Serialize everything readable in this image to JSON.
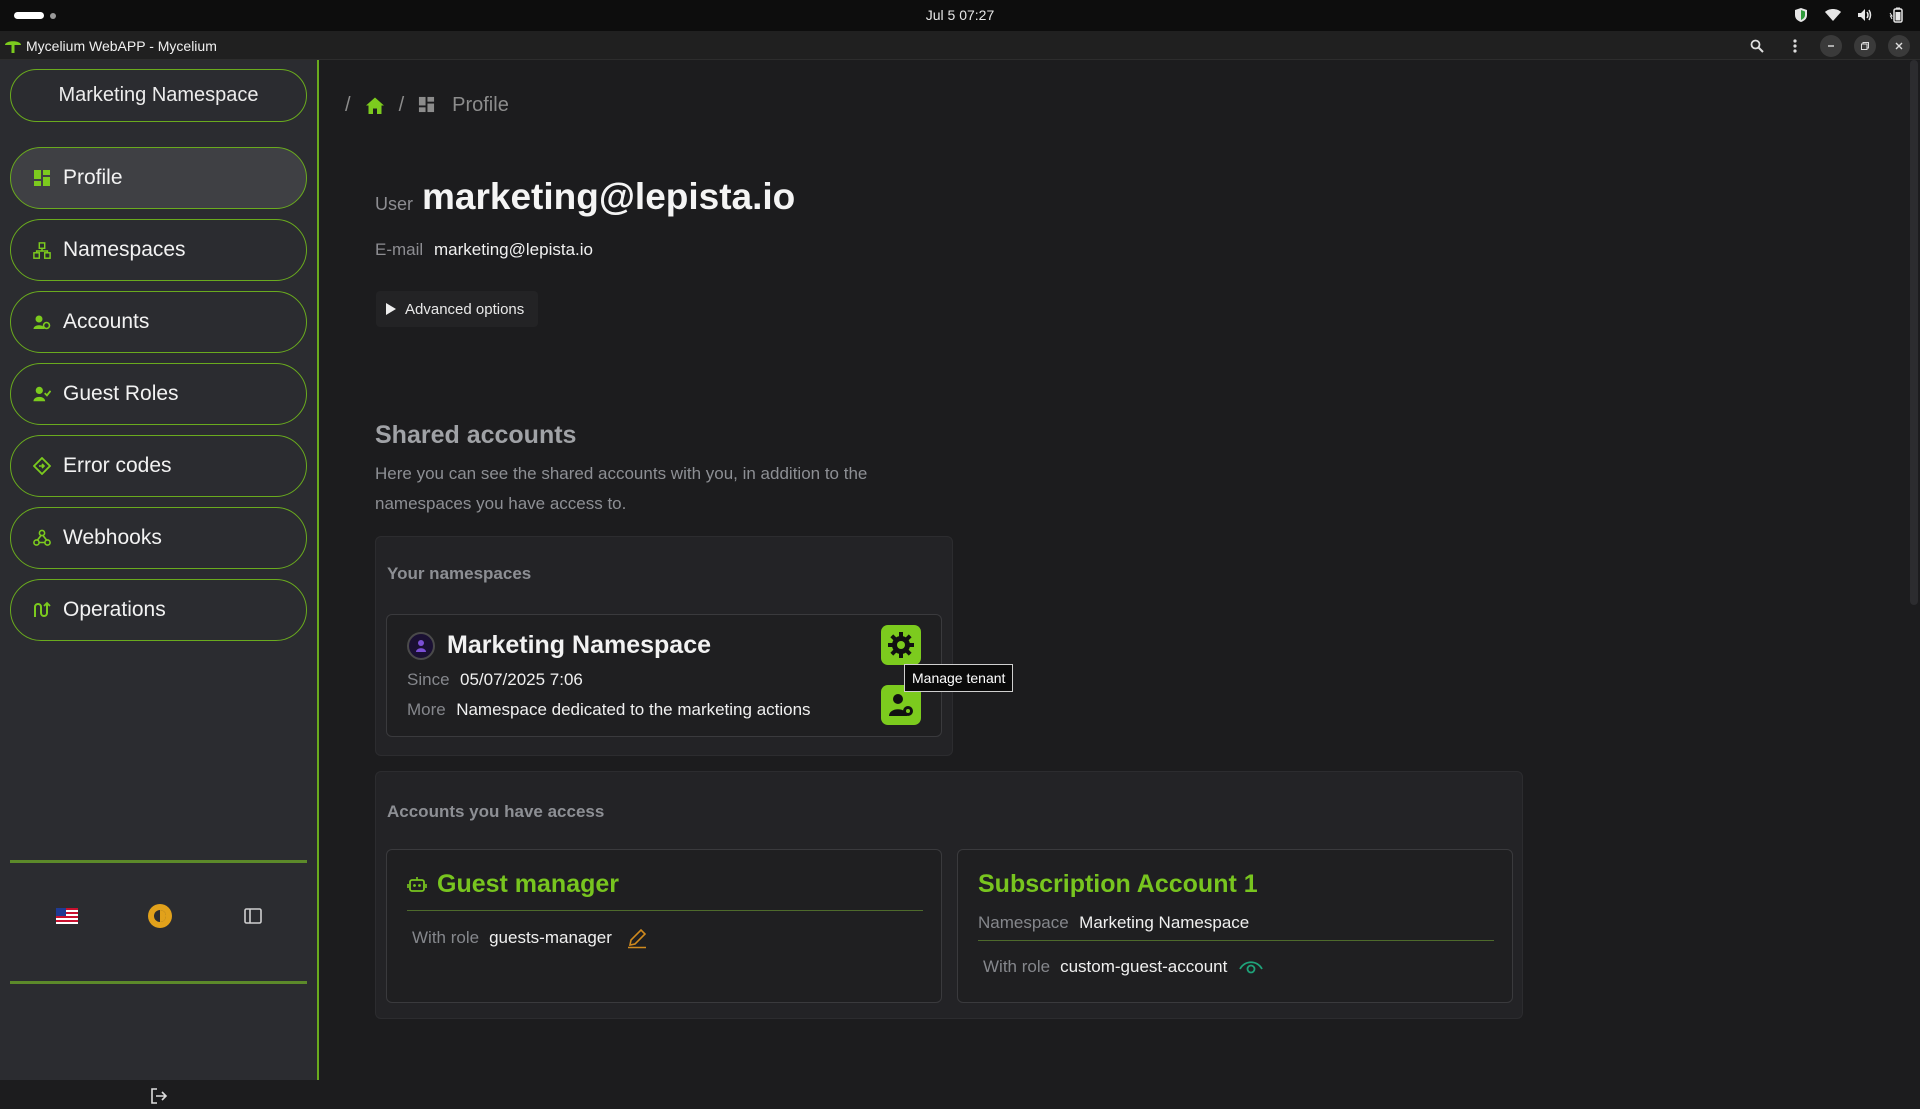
{
  "os": {
    "clock": "Jul 5  07:27"
  },
  "window": {
    "title": "Mycelium WebAPP - Mycelium"
  },
  "sidebar": {
    "namespace_selector": "Marketing Namespace",
    "items": [
      {
        "label": "Profile",
        "icon": "grid-icon",
        "active": true
      },
      {
        "label": "Namespaces",
        "icon": "namespaces-icon",
        "active": false
      },
      {
        "label": "Accounts",
        "icon": "accounts-icon",
        "active": false
      },
      {
        "label": "Guest Roles",
        "icon": "guest-roles-icon",
        "active": false
      },
      {
        "label": "Error codes",
        "icon": "error-codes-icon",
        "active": false
      },
      {
        "label": "Webhooks",
        "icon": "webhooks-icon",
        "active": false
      },
      {
        "label": "Operations",
        "icon": "operations-icon",
        "active": false
      }
    ],
    "tools": {
      "language_icon": "us-flag-icon",
      "theme_icon": "theme-toggle-icon",
      "panel_icon": "sidebar-toggle-icon"
    },
    "logout_icon": "logout-icon"
  },
  "breadcrumb": {
    "sep1": "/",
    "sep2": "/",
    "current": "Profile"
  },
  "profile": {
    "user_label": "User",
    "user_name": "marketing@lepista.io",
    "email_label": "E-mail",
    "email_value": "marketing@lepista.io",
    "advanced_options": "Advanced options"
  },
  "shared": {
    "heading": "Shared accounts",
    "description": "Here you can see the shared accounts with you, in addition to the namespaces you have access to."
  },
  "namespaces_panel": {
    "title": "Your namespaces",
    "card": {
      "name": "Marketing Namespace",
      "since_label": "Since",
      "since_value": "05/07/2025 7:06",
      "more_label": "More",
      "more_value": "Namespace dedicated to the marketing actions",
      "tooltip": "Manage tenant"
    }
  },
  "accounts_panel": {
    "title": "Accounts you have access",
    "cards": [
      {
        "name": "Guest manager",
        "role_label": "With role",
        "role_value": "guests-manager"
      },
      {
        "name": "Subscription Account 1",
        "namespace_label": "Namespace",
        "namespace_value": "Marketing Namespace",
        "role_label": "With role",
        "role_value": "custom-guest-account"
      }
    ]
  },
  "colors": {
    "accent": "#7ccb1e",
    "sidebar_bg": "#2b2c30",
    "main_bg": "#1c1c1e",
    "edit_orange": "#d08a1e",
    "view_teal": "#1fa37a"
  }
}
